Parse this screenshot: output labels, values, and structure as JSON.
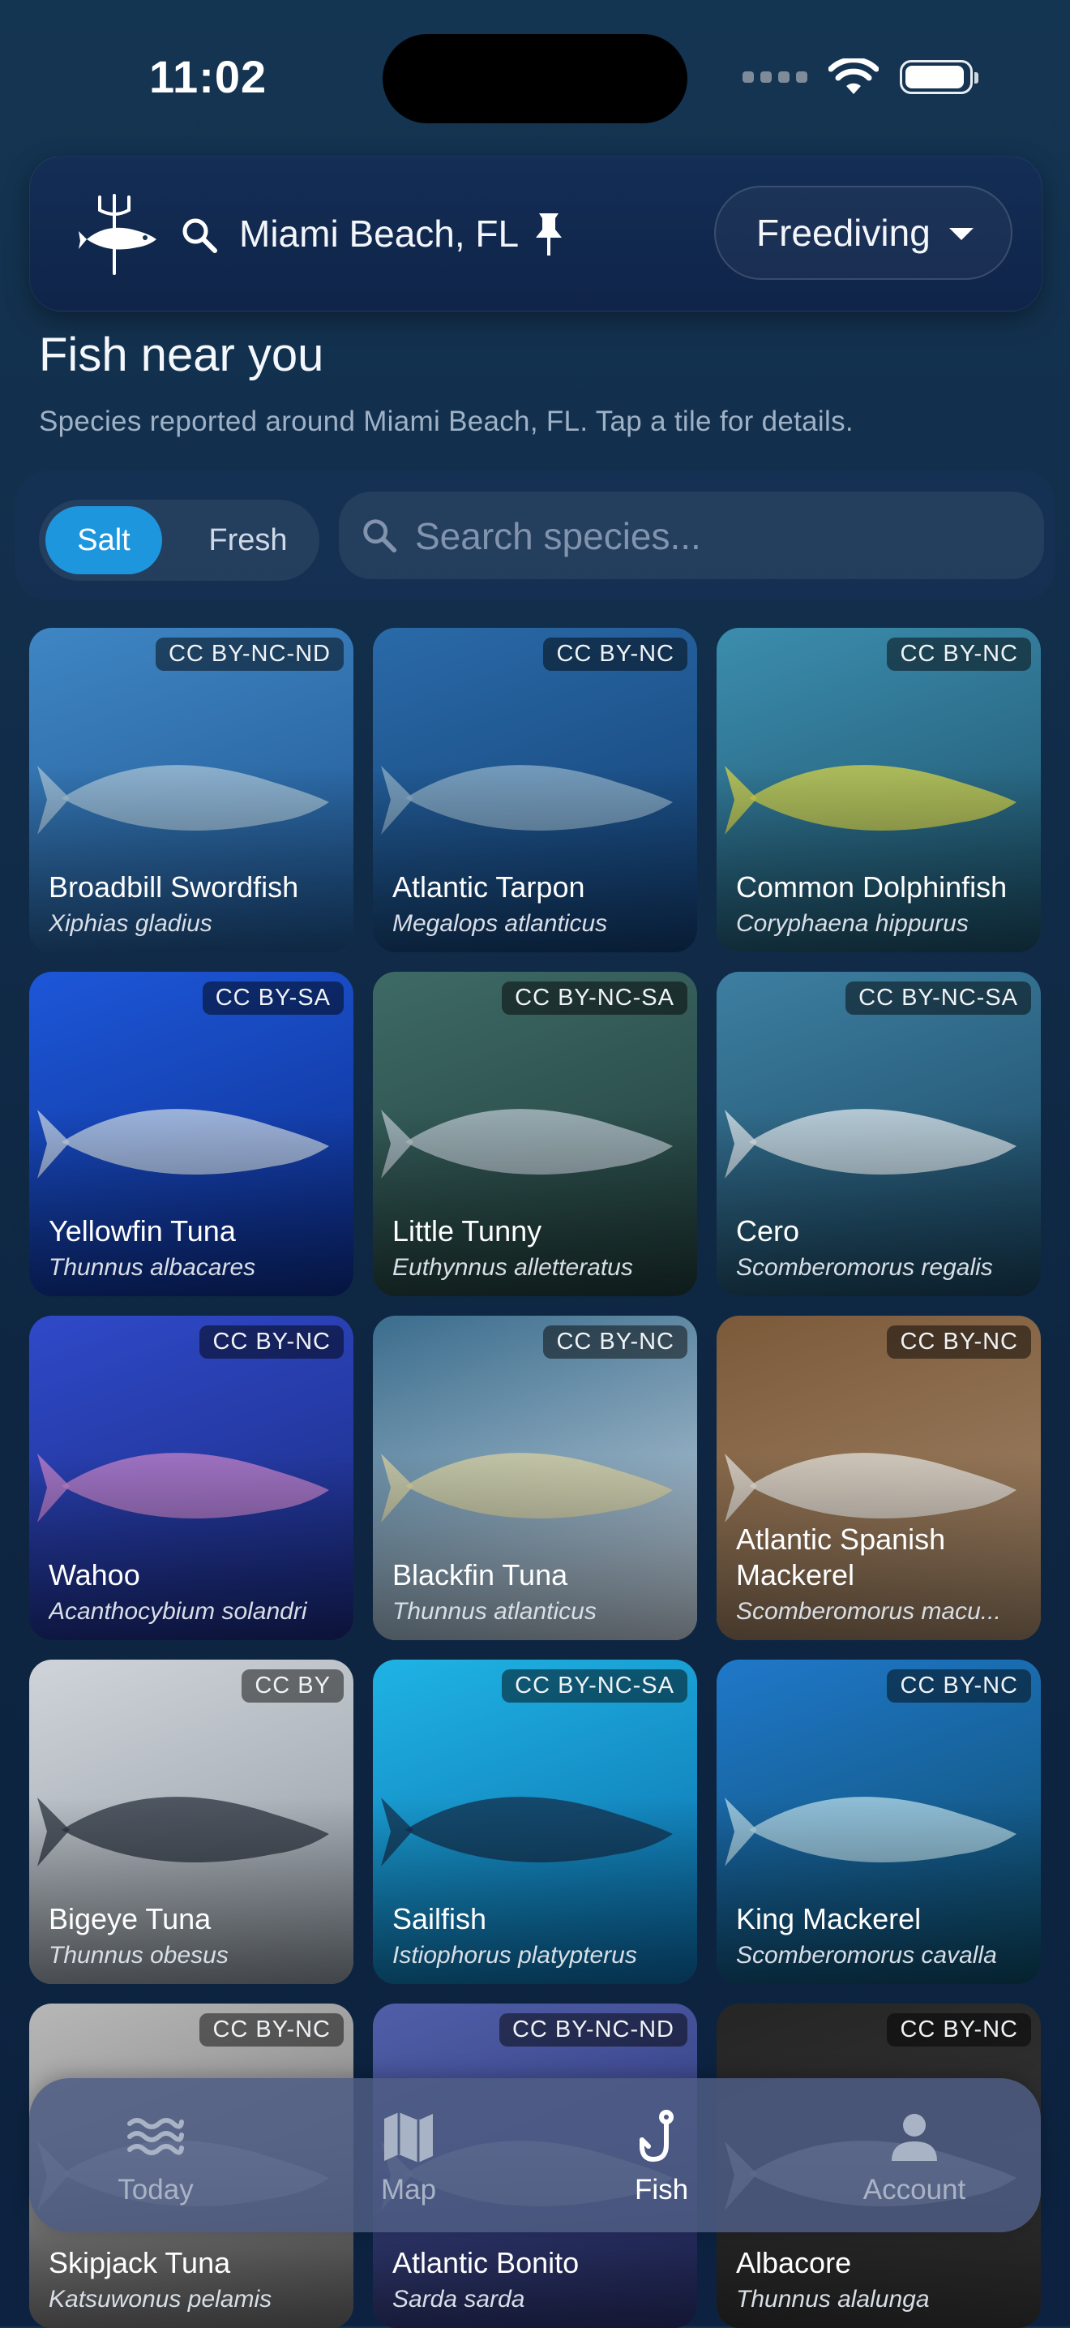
{
  "status_bar": {
    "time": "11:02",
    "battery_level": 0.95
  },
  "header": {
    "location": "Miami Beach, FL",
    "mode": "Freediving",
    "icons": [
      "trident-fish-logo",
      "search-icon",
      "pin-icon",
      "chevron-down-icon"
    ]
  },
  "page": {
    "title": "Fish near you",
    "subtitle": "Species reported around Miami Beach, FL. Tap a tile for details."
  },
  "filter": {
    "water_types": [
      "Salt",
      "Fresh"
    ],
    "selected": "Salt",
    "search_placeholder": "Search species..."
  },
  "species": [
    {
      "name": "Broadbill Swordfish",
      "scientific": "Xiphias gladius",
      "license": "CC BY-NC-ND"
    },
    {
      "name": "Atlantic Tarpon",
      "scientific": "Megalops atlanticus",
      "license": "CC BY-NC"
    },
    {
      "name": "Common Dolphinfish",
      "scientific": "Coryphaena hippurus",
      "license": "CC BY-NC"
    },
    {
      "name": "Yellowfin Tuna",
      "scientific": "Thunnus albacares",
      "license": "CC BY-SA"
    },
    {
      "name": "Little Tunny",
      "scientific": "Euthynnus alletteratus",
      "license": "CC BY-NC-SA"
    },
    {
      "name": "Cero",
      "scientific": "Scomberomorus regalis",
      "license": "CC BY-NC-SA"
    },
    {
      "name": "Wahoo",
      "scientific": "Acanthocybium solandri",
      "license": "CC BY-NC"
    },
    {
      "name": "Blackfin Tuna",
      "scientific": "Thunnus atlanticus",
      "license": "CC BY-NC"
    },
    {
      "name": "Atlantic Spanish Mackerel",
      "scientific": "Scomberomorus macu...",
      "license": "CC BY-NC"
    },
    {
      "name": "Bigeye Tuna",
      "scientific": "Thunnus obesus",
      "license": "CC BY"
    },
    {
      "name": "Sailfish",
      "scientific": "Istiophorus platypterus",
      "license": "CC BY-NC-SA"
    },
    {
      "name": "King Mackerel",
      "scientific": "Scomberomorus cavalla",
      "license": "CC BY-NC"
    },
    {
      "name": "Skipjack Tuna",
      "scientific": "Katsuwonus pelamis",
      "license": "CC BY-NC"
    },
    {
      "name": "Atlantic Bonito",
      "scientific": "Sarda sarda",
      "license": "CC BY-NC-ND"
    },
    {
      "name": "Albacore",
      "scientific": "Thunnus alalunga",
      "license": "CC BY-NC"
    }
  ],
  "tabs": [
    {
      "label": "Today",
      "icon": "waves-icon",
      "active": false
    },
    {
      "label": "Map",
      "icon": "map-icon",
      "active": false
    },
    {
      "label": "Fish",
      "icon": "fishhook-icon",
      "active": true
    },
    {
      "label": "Account",
      "icon": "person-icon",
      "active": false
    }
  ],
  "colors": {
    "accent": "#1e96de",
    "background": "#112d4a",
    "tabbar": "#4e5c82"
  }
}
